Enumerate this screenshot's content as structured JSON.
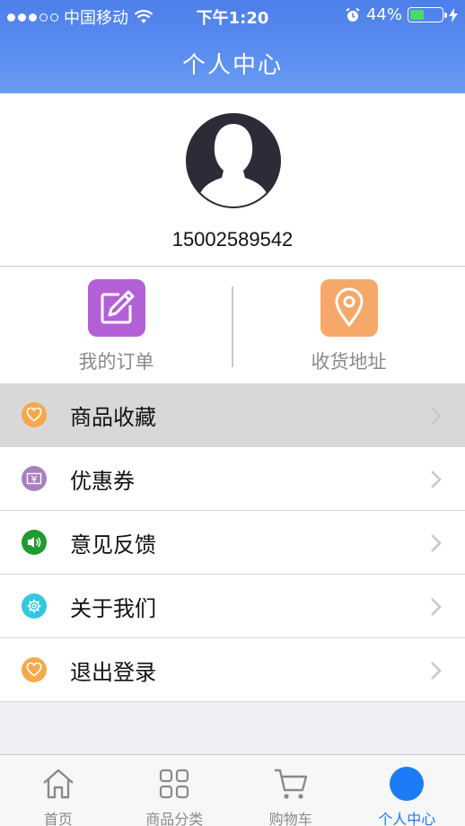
{
  "status_bar": {
    "carrier": "中国移动",
    "time": "下午1:20",
    "battery": "44%",
    "battery_level": 0.44
  },
  "header": {
    "title": "个人中心"
  },
  "profile": {
    "phone": "15002589542"
  },
  "quick_actions": [
    {
      "label": "我的订单",
      "icon": "edit-icon",
      "color": "#b35fd6"
    },
    {
      "label": "收货地址",
      "icon": "location-pin-icon",
      "color": "#f6a86a"
    }
  ],
  "menu": [
    {
      "label": "商品收藏",
      "icon": "heart-icon",
      "color": "#f5a94a",
      "active": true
    },
    {
      "label": "优惠券",
      "icon": "coupon-icon",
      "color": "#a97fc0"
    },
    {
      "label": "意见反馈",
      "icon": "speaker-icon",
      "color": "#1f9a2f"
    },
    {
      "label": "关于我们",
      "icon": "gear-icon",
      "color": "#33c7e0"
    },
    {
      "label": "退出登录",
      "icon": "heart-icon",
      "color": "#f5a94a"
    }
  ],
  "tabbar": [
    {
      "label": "首页",
      "icon": "home-icon"
    },
    {
      "label": "商品分类",
      "icon": "grid-icon"
    },
    {
      "label": "购物车",
      "icon": "cart-icon"
    },
    {
      "label": "个人中心",
      "icon": "profile-icon",
      "active": true
    }
  ],
  "colors": {
    "header": "#5b8ef0",
    "accent": "#1b7cf5"
  }
}
